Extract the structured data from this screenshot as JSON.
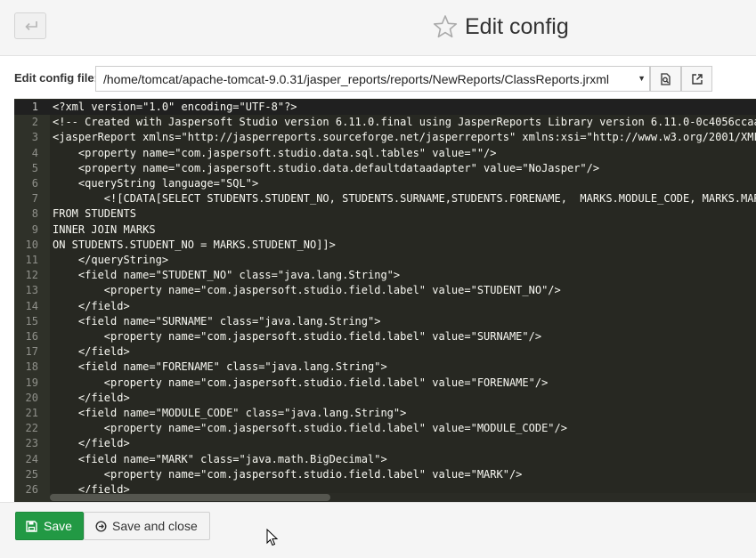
{
  "header": {
    "title": "Edit config",
    "back_icon": "return-arrow-icon",
    "favorite_icon": "star-icon"
  },
  "file_bar": {
    "label": "Edit config file:",
    "selected_file": "/home/tomcat/apache-tomcat-9.0.31/jasper_reports/reports/NewReports/ClassReports.jrxml",
    "caret_icon": "caret-down-icon",
    "preview_icon": "file-search-icon",
    "open_icon": "external-link-icon"
  },
  "editor": {
    "active_line": 1,
    "lines": [
      {
        "n": "1",
        "text": "<?xml version=\"1.0\" encoding=\"UTF-8\"?>"
      },
      {
        "n": "2",
        "text": "<!-- Created with Jaspersoft Studio version 6.11.0.final using JasperReports Library version 6.11.0-0c4056ccaa"
      },
      {
        "n": "3",
        "text": "<jasperReport xmlns=\"http://jasperreports.sourceforge.net/jasperreports\" xmlns:xsi=\"http://www.w3.org/2001/XML"
      },
      {
        "n": "4",
        "text": "    <property name=\"com.jaspersoft.studio.data.sql.tables\" value=\"\"/>"
      },
      {
        "n": "5",
        "text": "    <property name=\"com.jaspersoft.studio.data.defaultdataadapter\" value=\"NoJasper\"/>"
      },
      {
        "n": "6",
        "text": "    <queryString language=\"SQL\">"
      },
      {
        "n": "7",
        "text": "        <![CDATA[SELECT STUDENTS.STUDENT_NO, STUDENTS.SURNAME,STUDENTS.FORENAME,  MARKS.MODULE_CODE, MARKS.MAR"
      },
      {
        "n": "8",
        "text": "FROM STUDENTS"
      },
      {
        "n": "9",
        "text": "INNER JOIN MARKS"
      },
      {
        "n": "10",
        "text": "ON STUDENTS.STUDENT_NO = MARKS.STUDENT_NO]]>"
      },
      {
        "n": "11",
        "text": "    </queryString>"
      },
      {
        "n": "12",
        "text": "    <field name=\"STUDENT_NO\" class=\"java.lang.String\">"
      },
      {
        "n": "13",
        "text": "        <property name=\"com.jaspersoft.studio.field.label\" value=\"STUDENT_NO\"/>"
      },
      {
        "n": "14",
        "text": "    </field>"
      },
      {
        "n": "15",
        "text": "    <field name=\"SURNAME\" class=\"java.lang.String\">"
      },
      {
        "n": "16",
        "text": "        <property name=\"com.jaspersoft.studio.field.label\" value=\"SURNAME\"/>"
      },
      {
        "n": "17",
        "text": "    </field>"
      },
      {
        "n": "18",
        "text": "    <field name=\"FORENAME\" class=\"java.lang.String\">"
      },
      {
        "n": "19",
        "text": "        <property name=\"com.jaspersoft.studio.field.label\" value=\"FORENAME\"/>"
      },
      {
        "n": "20",
        "text": "    </field>"
      },
      {
        "n": "21",
        "text": "    <field name=\"MODULE_CODE\" class=\"java.lang.String\">"
      },
      {
        "n": "22",
        "text": "        <property name=\"com.jaspersoft.studio.field.label\" value=\"MODULE_CODE\"/>"
      },
      {
        "n": "23",
        "text": "    </field>"
      },
      {
        "n": "24",
        "text": "    <field name=\"MARK\" class=\"java.math.BigDecimal\">"
      },
      {
        "n": "25",
        "text": "        <property name=\"com.jaspersoft.studio.field.label\" value=\"MARK\"/>"
      },
      {
        "n": "26",
        "text": "    </field>"
      }
    ]
  },
  "footer": {
    "save_label": "Save",
    "save_icon": "floppy-disk-icon",
    "save_close_label": "Save and close",
    "save_close_icon": "circle-arrow-icon"
  },
  "colors": {
    "editor_bg": "#272822",
    "editor_text": "#f8f8f2",
    "save_button": "#229944"
  }
}
